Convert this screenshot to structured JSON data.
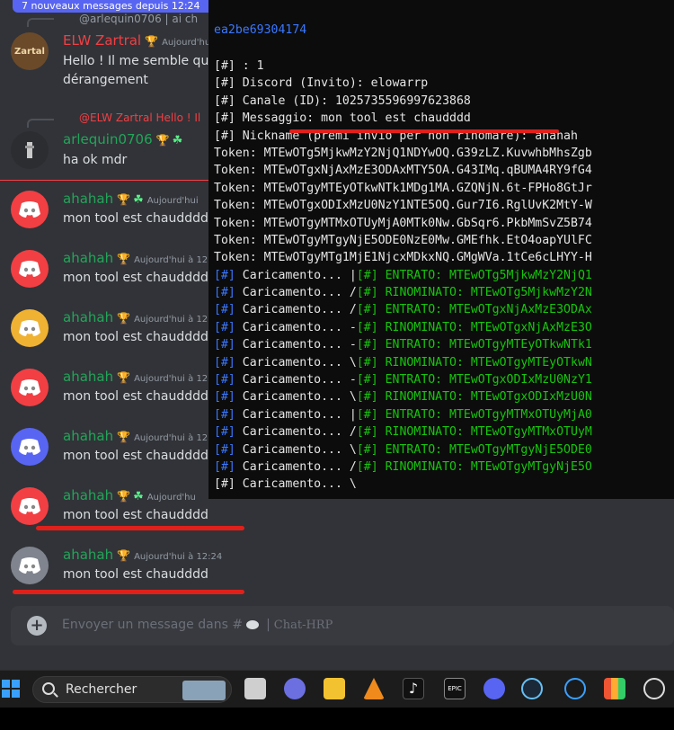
{
  "chat": {
    "new_messages_banner": "7 nouveaux messages depuis 12:24",
    "messages": [
      {
        "reply_preview": "@arlequin0706 | ai ch",
        "username": "ELW Zartral",
        "timestamp": "Aujourd'hui",
        "text_line1": "Hello ! Il me semble que",
        "text_line2": "dérangement",
        "avatar_text": "Zartal"
      },
      {
        "reply_preview": "@ELW Zartral Hello ! Il",
        "username": "arlequin0706",
        "text": "ha ok mdr"
      },
      {
        "username": "ahahah",
        "timestamp": "Aujourd'hui",
        "text": "mon tool est chaudddd",
        "avatar_color": "#f23f43"
      },
      {
        "username": "ahahah",
        "timestamp": "Aujourd'hui à 12",
        "text": "mon tool est chaudddd",
        "avatar_color": "#f23f43"
      },
      {
        "username": "ahahah",
        "timestamp": "Aujourd'hui à 12",
        "text": "mon tool est chaudddd",
        "avatar_color": "#f0b232"
      },
      {
        "username": "ahahah",
        "timestamp": "Aujourd'hui à 12",
        "text": "mon tool est chaudddd",
        "avatar_color": "#f23f43"
      },
      {
        "username": "ahahah",
        "timestamp": "Aujourd'hui à 12",
        "text": "mon tool est chaudddd",
        "avatar_color": "#5865f2"
      },
      {
        "username": "ahahah",
        "timestamp": "Aujourd'hu",
        "text": "mon tool est chaudddd",
        "avatar_color": "#f23f43"
      },
      {
        "username": "ahahah",
        "timestamp": "Aujourd'hui à 12:24",
        "text": "mon tool est chaudddd",
        "avatar_color": "#80848e"
      }
    ],
    "input_placeholder": "Envoyer un message dans #",
    "input_channel": "Chat-HRP",
    "username_color": "#23a559",
    "zartal_name_color": "#f23f43"
  },
  "terminal": {
    "header": "ea2be69304174",
    "lines": [
      "[#] : 1",
      "[#] Discord (Invito): elowarrp",
      "[#] Canale (ID): 1025735596997623868",
      "[#] Messaggio: mon tool est chaudddd",
      "[#] Nickname (premi invio per non rinomare): ahahah",
      "Token: MTEwOTg5MjkwMzY2NjQ1NDYwOQ.G39zLZ.KuvwhbMhsZgb",
      "Token: MTEwOTgxNjAxMzE3ODAxMTY5OA.G43IMq.qBUMA4RY9fG4",
      "Token: MTEwOTgyMTEyOTkwNTk1MDg1MA.GZQNjN.6t-FPHo8GtJr",
      "Token: MTEwOTgxODIxMzU0NzY1NTE5OQ.Gur7I6.RglUvK2MtY-W",
      "Token: MTEwOTgyMTMxOTUyMjA0MTk0Nw.GbSqr6.PkbMmSvZ5B74",
      "Token: MTEwOTgyMTgyNjE5ODE0NzE0Mw.GMEfhk.EtO4oapYUlFC",
      "Token: MTEwOTgyMTg1MjE1NjcxMDkxNQ.GMgWVa.1tCe6cLHYY-H"
    ],
    "loading_lines": [
      {
        "prefix": "[#] Caricamento... |",
        "status": "[#] ENTRATO: MTEwOTg5MjkwMzY2NjQ1"
      },
      {
        "prefix": "[#] Caricamento... /",
        "status": "[#] RINOMINATO: MTEwOTg5MjkwMzY2N"
      },
      {
        "prefix": "[#] Caricamento... /",
        "status": "[#] ENTRATO: MTEwOTgxNjAxMzE3ODAx"
      },
      {
        "prefix": "[#] Caricamento... -",
        "status": "[#] RINOMINATO: MTEwOTgxNjAxMzE3O"
      },
      {
        "prefix": "[#] Caricamento... -",
        "status": "[#] ENTRATO: MTEwOTgyMTEyOTkwNTk1"
      },
      {
        "prefix": "[#] Caricamento... \\",
        "status": "[#] RINOMINATO: MTEwOTgyMTEyOTkwN"
      },
      {
        "prefix": "[#] Caricamento... -",
        "status": "[#] ENTRATO: MTEwOTgxODIxMzU0NzY1"
      },
      {
        "prefix": "[#] Caricamento... \\",
        "status": "[#] RINOMINATO: MTEwOTgxODIxMzU0N"
      },
      {
        "prefix": "[#] Caricamento... |",
        "status": "[#] ENTRATO: MTEwOTgyMTMxOTUyMjA0"
      },
      {
        "prefix": "[#] Caricamento... /",
        "status": "[#] RINOMINATO: MTEwOTgyMTMxOTUyM"
      },
      {
        "prefix": "[#] Caricamento... \\",
        "status": "[#] ENTRATO: MTEwOTgyMTgyNjE5ODE0"
      },
      {
        "prefix": "[#] Caricamento... /",
        "status": "[#] RINOMINATO: MTEwOTgyMTgyNjE5O"
      }
    ],
    "last_line": "[#] Caricamento... \\"
  },
  "taskbar": {
    "search_label": "Rechercher",
    "icons": [
      "windows-start-icon",
      "task-view-icon",
      "teams-icon",
      "file-explorer-icon",
      "vlc-icon",
      "tiktok-icon",
      "epic-games-icon",
      "discord-icon",
      "steam-icon",
      "app-icon",
      "audio-app-icon",
      "obs-icon"
    ]
  }
}
